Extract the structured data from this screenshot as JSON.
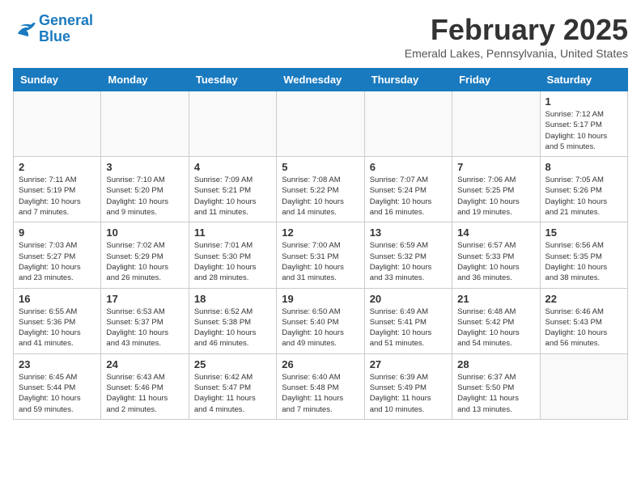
{
  "logo": {
    "line1": "General",
    "line2": "Blue"
  },
  "title": "February 2025",
  "location": "Emerald Lakes, Pennsylvania, United States",
  "days_of_week": [
    "Sunday",
    "Monday",
    "Tuesday",
    "Wednesday",
    "Thursday",
    "Friday",
    "Saturday"
  ],
  "weeks": [
    [
      {
        "day": "",
        "info": ""
      },
      {
        "day": "",
        "info": ""
      },
      {
        "day": "",
        "info": ""
      },
      {
        "day": "",
        "info": ""
      },
      {
        "day": "",
        "info": ""
      },
      {
        "day": "",
        "info": ""
      },
      {
        "day": "1",
        "info": "Sunrise: 7:12 AM\nSunset: 5:17 PM\nDaylight: 10 hours\nand 5 minutes."
      }
    ],
    [
      {
        "day": "2",
        "info": "Sunrise: 7:11 AM\nSunset: 5:19 PM\nDaylight: 10 hours\nand 7 minutes."
      },
      {
        "day": "3",
        "info": "Sunrise: 7:10 AM\nSunset: 5:20 PM\nDaylight: 10 hours\nand 9 minutes."
      },
      {
        "day": "4",
        "info": "Sunrise: 7:09 AM\nSunset: 5:21 PM\nDaylight: 10 hours\nand 11 minutes."
      },
      {
        "day": "5",
        "info": "Sunrise: 7:08 AM\nSunset: 5:22 PM\nDaylight: 10 hours\nand 14 minutes."
      },
      {
        "day": "6",
        "info": "Sunrise: 7:07 AM\nSunset: 5:24 PM\nDaylight: 10 hours\nand 16 minutes."
      },
      {
        "day": "7",
        "info": "Sunrise: 7:06 AM\nSunset: 5:25 PM\nDaylight: 10 hours\nand 19 minutes."
      },
      {
        "day": "8",
        "info": "Sunrise: 7:05 AM\nSunset: 5:26 PM\nDaylight: 10 hours\nand 21 minutes."
      }
    ],
    [
      {
        "day": "9",
        "info": "Sunrise: 7:03 AM\nSunset: 5:27 PM\nDaylight: 10 hours\nand 23 minutes."
      },
      {
        "day": "10",
        "info": "Sunrise: 7:02 AM\nSunset: 5:29 PM\nDaylight: 10 hours\nand 26 minutes."
      },
      {
        "day": "11",
        "info": "Sunrise: 7:01 AM\nSunset: 5:30 PM\nDaylight: 10 hours\nand 28 minutes."
      },
      {
        "day": "12",
        "info": "Sunrise: 7:00 AM\nSunset: 5:31 PM\nDaylight: 10 hours\nand 31 minutes."
      },
      {
        "day": "13",
        "info": "Sunrise: 6:59 AM\nSunset: 5:32 PM\nDaylight: 10 hours\nand 33 minutes."
      },
      {
        "day": "14",
        "info": "Sunrise: 6:57 AM\nSunset: 5:33 PM\nDaylight: 10 hours\nand 36 minutes."
      },
      {
        "day": "15",
        "info": "Sunrise: 6:56 AM\nSunset: 5:35 PM\nDaylight: 10 hours\nand 38 minutes."
      }
    ],
    [
      {
        "day": "16",
        "info": "Sunrise: 6:55 AM\nSunset: 5:36 PM\nDaylight: 10 hours\nand 41 minutes."
      },
      {
        "day": "17",
        "info": "Sunrise: 6:53 AM\nSunset: 5:37 PM\nDaylight: 10 hours\nand 43 minutes."
      },
      {
        "day": "18",
        "info": "Sunrise: 6:52 AM\nSunset: 5:38 PM\nDaylight: 10 hours\nand 46 minutes."
      },
      {
        "day": "19",
        "info": "Sunrise: 6:50 AM\nSunset: 5:40 PM\nDaylight: 10 hours\nand 49 minutes."
      },
      {
        "day": "20",
        "info": "Sunrise: 6:49 AM\nSunset: 5:41 PM\nDaylight: 10 hours\nand 51 minutes."
      },
      {
        "day": "21",
        "info": "Sunrise: 6:48 AM\nSunset: 5:42 PM\nDaylight: 10 hours\nand 54 minutes."
      },
      {
        "day": "22",
        "info": "Sunrise: 6:46 AM\nSunset: 5:43 PM\nDaylight: 10 hours\nand 56 minutes."
      }
    ],
    [
      {
        "day": "23",
        "info": "Sunrise: 6:45 AM\nSunset: 5:44 PM\nDaylight: 10 hours\nand 59 minutes."
      },
      {
        "day": "24",
        "info": "Sunrise: 6:43 AM\nSunset: 5:46 PM\nDaylight: 11 hours\nand 2 minutes."
      },
      {
        "day": "25",
        "info": "Sunrise: 6:42 AM\nSunset: 5:47 PM\nDaylight: 11 hours\nand 4 minutes."
      },
      {
        "day": "26",
        "info": "Sunrise: 6:40 AM\nSunset: 5:48 PM\nDaylight: 11 hours\nand 7 minutes."
      },
      {
        "day": "27",
        "info": "Sunrise: 6:39 AM\nSunset: 5:49 PM\nDaylight: 11 hours\nand 10 minutes."
      },
      {
        "day": "28",
        "info": "Sunrise: 6:37 AM\nSunset: 5:50 PM\nDaylight: 11 hours\nand 13 minutes."
      },
      {
        "day": "",
        "info": ""
      }
    ]
  ]
}
